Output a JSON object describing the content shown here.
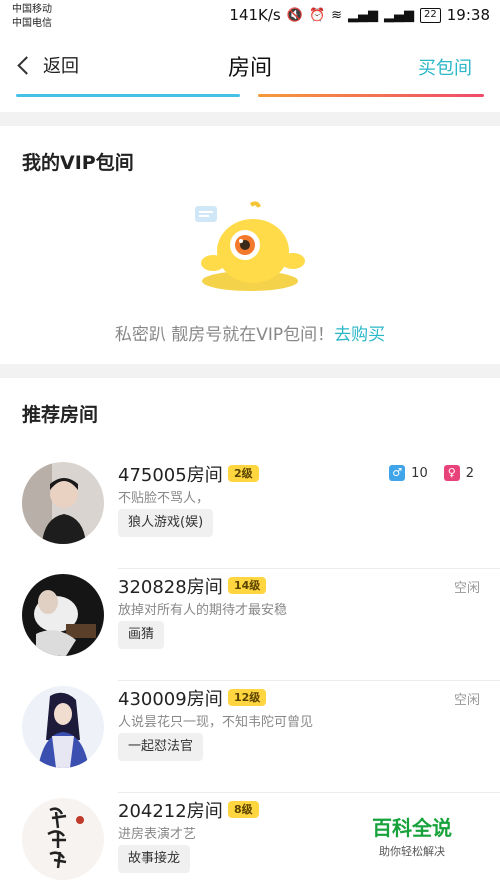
{
  "status_bar": {
    "carrier1": "中国移动",
    "carrier2": "中国电信",
    "speed": "141K/s",
    "signal1": "²⁶",
    "signal2": "⁴⁶₂₆",
    "battery": "22",
    "time": "19:38"
  },
  "nav": {
    "back_label": "返回",
    "title": "房间",
    "buy_room": "买包间"
  },
  "vip": {
    "title": "我的VIP包间",
    "text": "私密趴 靓房号就在VIP包间！",
    "link": "去购买"
  },
  "recommended": {
    "title": "推荐房间",
    "rooms": [
      {
        "name": "475005房间",
        "level": "2级",
        "desc": "不贴脸不骂人，",
        "tag": "狼人游戏(娱)",
        "male_count": "10",
        "female_count": "2"
      },
      {
        "name": "320828房间",
        "level": "14级",
        "desc": "放掉对所有人的期待才最安稳",
        "tag": "画猜",
        "status": "空闲"
      },
      {
        "name": "430009房间",
        "level": "12级",
        "desc": "人说昙花只一现，不知韦陀可曾见",
        "tag": "一起怼法官",
        "status": "空闲"
      },
      {
        "name": "204212房间",
        "level": "8级",
        "desc": "进房表演才艺",
        "tag": "故事接龙"
      }
    ]
  },
  "watermark": {
    "main": "百科全说",
    "sub": "助你轻松解决"
  },
  "colors": {
    "accent": "#2ab7c8",
    "level_badge": "#ffd640",
    "male": "#3fa4e8",
    "female": "#e8427a"
  }
}
